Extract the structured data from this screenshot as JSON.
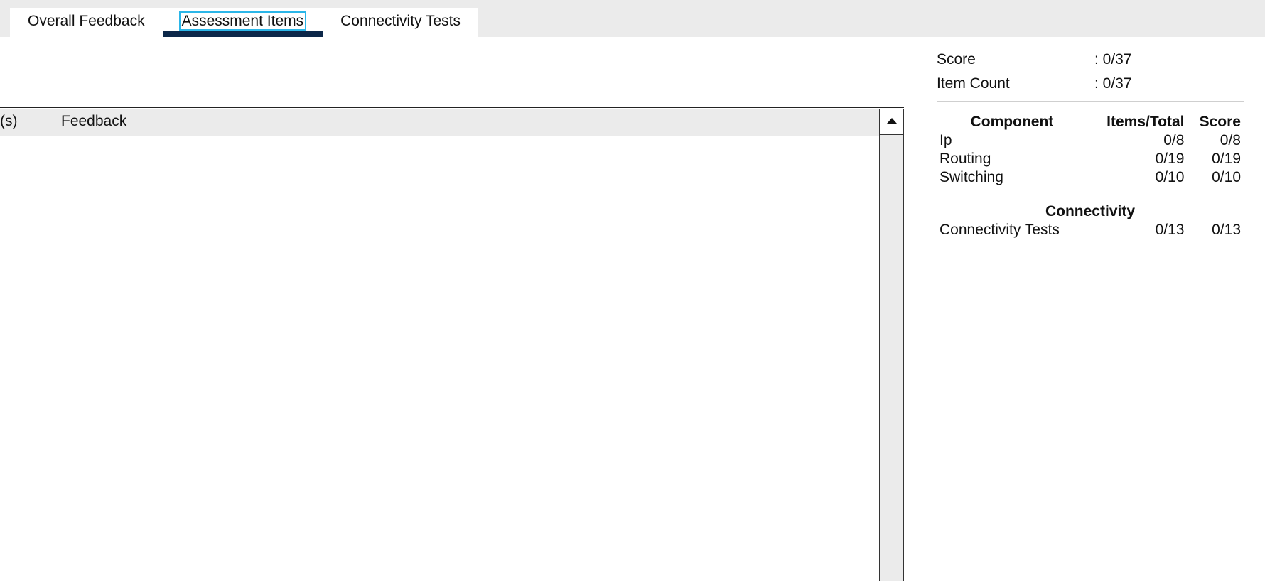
{
  "tabs": [
    {
      "label": "Overall Feedback",
      "active": false
    },
    {
      "label": "Assessment Items",
      "active": true
    },
    {
      "label": "Connectivity Tests",
      "active": false
    }
  ],
  "table": {
    "columns": [
      "(s)",
      "Feedback"
    ],
    "rows": []
  },
  "summary": {
    "score_label": "Score",
    "score_value": ": 0/37",
    "item_count_label": "Item Count",
    "item_count_value": ": 0/37",
    "components_header": {
      "name": "Component",
      "items_total": "Items/Total",
      "score": "Score"
    },
    "components": [
      {
        "name": "Ip",
        "items_total": "0/8",
        "score": "0/8"
      },
      {
        "name": "Routing",
        "items_total": "0/19",
        "score": "0/19"
      },
      {
        "name": "Switching",
        "items_total": "0/10",
        "score": "0/10"
      }
    ],
    "connectivity_title": "Connectivity",
    "connectivity": [
      {
        "name": "Connectivity Tests",
        "items_total": "0/13",
        "score": "0/13"
      }
    ]
  },
  "colors": {
    "accent_underline": "#0c2749",
    "focus_outline": "#2bb6e8",
    "tabbar_bg": "#ebebeb"
  }
}
